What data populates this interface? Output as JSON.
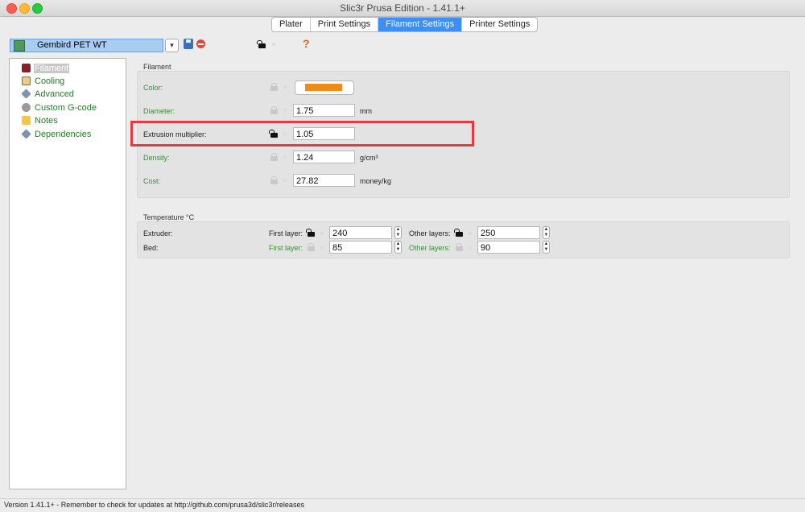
{
  "window": {
    "title": "Slic3r Prusa Edition - 1.41.1+"
  },
  "tabs": [
    "Plater",
    "Print Settings",
    "Filament Settings",
    "Printer Settings"
  ],
  "active_tab": "Filament Settings",
  "preset": {
    "name": "Gembird PET WT",
    "dropdown_icon": "chevron-down-icon"
  },
  "toolbar": {
    "help_label": "?"
  },
  "sidebar": {
    "items": [
      {
        "label": "Filament",
        "icon": "filament-icon",
        "selected": true
      },
      {
        "label": "Cooling",
        "icon": "hourglass-icon"
      },
      {
        "label": "Advanced",
        "icon": "wrench-icon"
      },
      {
        "label": "Custom G-code",
        "icon": "gear-icon"
      },
      {
        "label": "Notes",
        "icon": "note-icon"
      },
      {
        "label": "Dependencies",
        "icon": "wrench-icon"
      }
    ]
  },
  "filament_group": {
    "title": "Filament",
    "color_label": "Color:",
    "color_value": "#f08a19",
    "diameter": {
      "label": "Diameter:",
      "value": "1.75",
      "unit": "mm"
    },
    "extrusion": {
      "label": "Extrusion multiplier:",
      "value": "1.05"
    },
    "density": {
      "label": "Density:",
      "value": "1.24",
      "unit": "g/cm³"
    },
    "cost": {
      "label": "Cost:",
      "value": "27.82",
      "unit": "money/kg"
    }
  },
  "temperature_group": {
    "title": "Temperature °C",
    "extruder": {
      "label": "Extruder:",
      "first_label": "First layer:",
      "first_value": "240",
      "other_label": "Other layers:",
      "other_value": "250"
    },
    "bed": {
      "label": "Bed:",
      "first_label": "First layer:",
      "first_value": "85",
      "other_label": "Other layers:",
      "other_value": "90"
    }
  },
  "status_bar": {
    "text": "Version 1.41.1+ - Remember to check for updates at http://github.com/prusa3d/slic3r/releases"
  },
  "colors": {
    "accent": "#3d8ef5",
    "label_green": "#3b8a3b",
    "highlight_red": "#e53a42"
  }
}
